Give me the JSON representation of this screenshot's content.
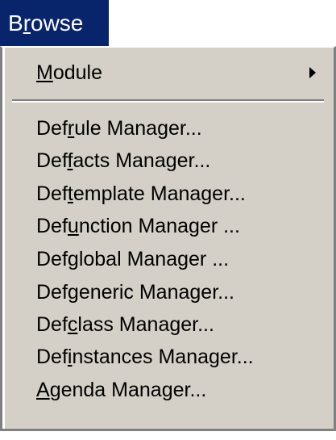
{
  "menubar": {
    "menu_title": {
      "before": "B",
      "accel": "r",
      "after": "owse"
    }
  },
  "menu": {
    "items": [
      {
        "before": "",
        "accel": "M",
        "after": "odule",
        "has_submenu": true
      },
      {
        "before": "Def",
        "accel": "r",
        "after": "ule Manager..."
      },
      {
        "before": "Def",
        "accel": "f",
        "after": "acts Manager..."
      },
      {
        "before": "Def",
        "accel": "t",
        "after": "emplate Manager..."
      },
      {
        "before": "Def",
        "accel": "u",
        "after": "nction Manager ..."
      },
      {
        "before": "Def",
        "accel": "g",
        "after": "lobal Manager ..."
      },
      {
        "before": "Def",
        "accel": "g",
        "after": "eneric Manager..."
      },
      {
        "before": "Def",
        "accel": "c",
        "after": "lass Manager..."
      },
      {
        "before": "Def",
        "accel": "i",
        "after": "nstances Manager..."
      },
      {
        "before": "",
        "accel": "A",
        "after": "genda Manager..."
      }
    ]
  },
  "colors": {
    "menubar_highlight": "#08246b",
    "menu_background": "#d4d0c8"
  }
}
